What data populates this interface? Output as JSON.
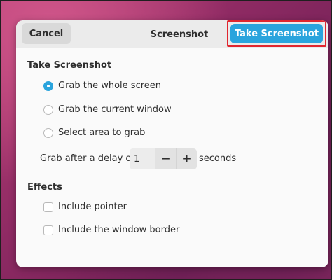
{
  "header": {
    "cancel_label": "Cancel",
    "title": "Screenshot",
    "take_label": "Take Screenshot"
  },
  "take_section": {
    "title": "Take Screenshot",
    "options": [
      {
        "label": "Grab the whole screen",
        "selected": true
      },
      {
        "label": "Grab the current window",
        "selected": false
      },
      {
        "label": "Select area to grab",
        "selected": false
      }
    ],
    "delay": {
      "prefix": "Grab after a delay of",
      "value": "1",
      "decrement": "−",
      "increment": "+",
      "suffix": "seconds"
    }
  },
  "effects_section": {
    "title": "Effects",
    "options": [
      {
        "label": "Include pointer",
        "checked": false
      },
      {
        "label": "Include the window border",
        "checked": false
      }
    ]
  },
  "colors": {
    "accent": "#2aa4dd",
    "highlight_border": "#e0262f"
  }
}
